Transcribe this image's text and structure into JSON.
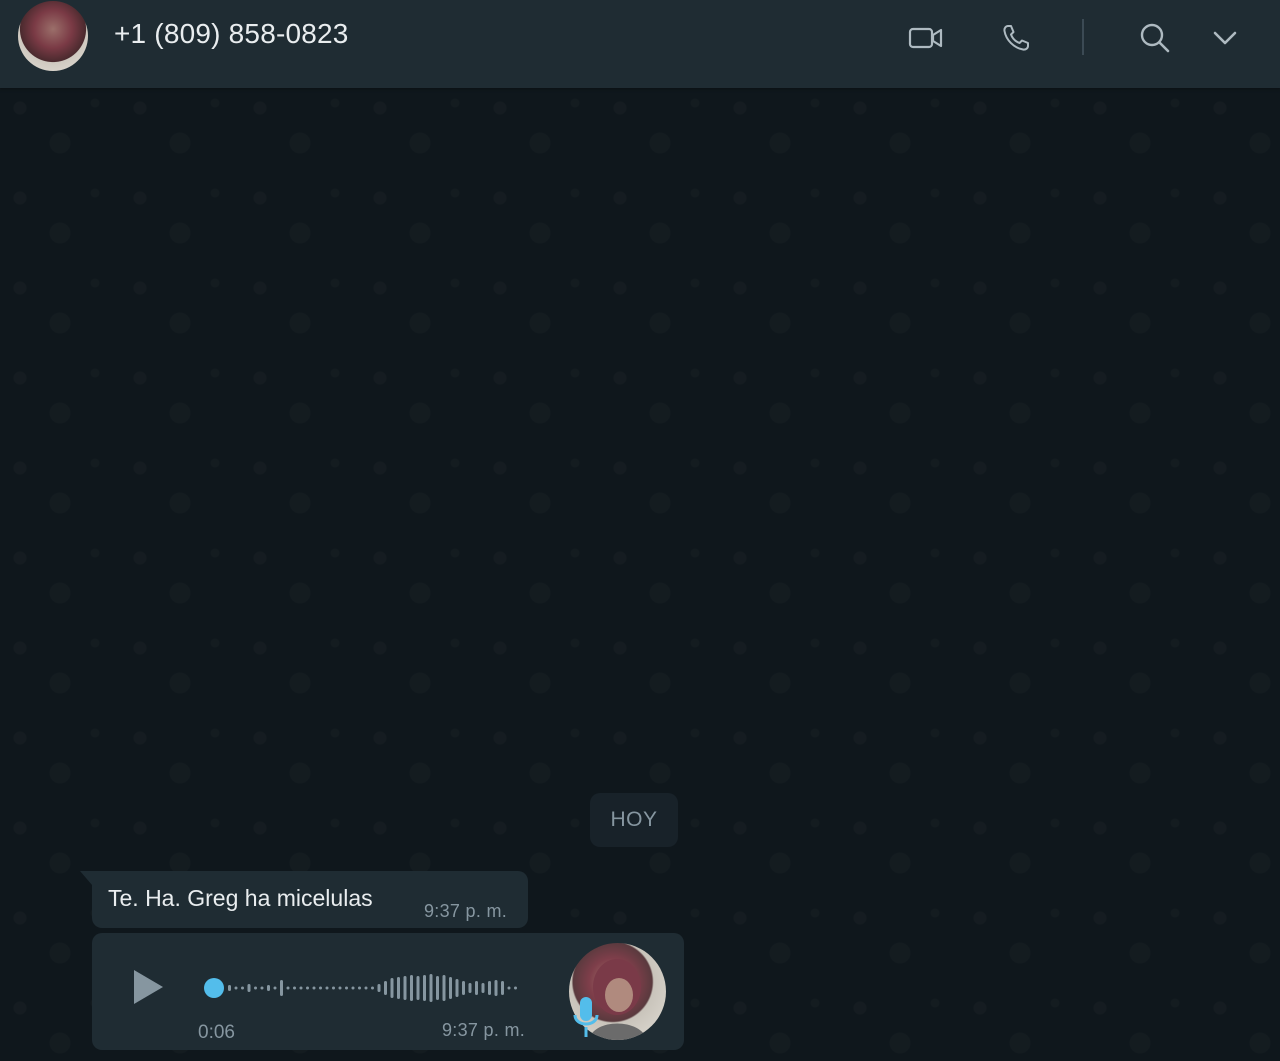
{
  "header": {
    "contact_name": "+1 (809) 858-0823",
    "avatar_icon": "contact-avatar",
    "actions": [
      {
        "icon": "video-call-icon"
      },
      {
        "icon": "voice-call-icon"
      },
      {
        "icon": "search-icon"
      },
      {
        "icon": "chevron-down-icon"
      }
    ]
  },
  "chat": {
    "date_label": "HOY",
    "messages": [
      {
        "type": "text",
        "text": "Te. Ha. Greg ha micelulas",
        "time": "9:37 p. m."
      },
      {
        "type": "voice",
        "duration": "0:06",
        "time": "9:37 p. m.",
        "progress": 0,
        "played": false
      }
    ]
  },
  "colors": {
    "header_bg": "#1f2c33",
    "chat_bg": "#0f171c",
    "bubble_bg": "#1f2c33",
    "accent_blue": "#53bdeb",
    "text_primary": "#e9edef",
    "text_secondary": "#8696a0"
  }
}
